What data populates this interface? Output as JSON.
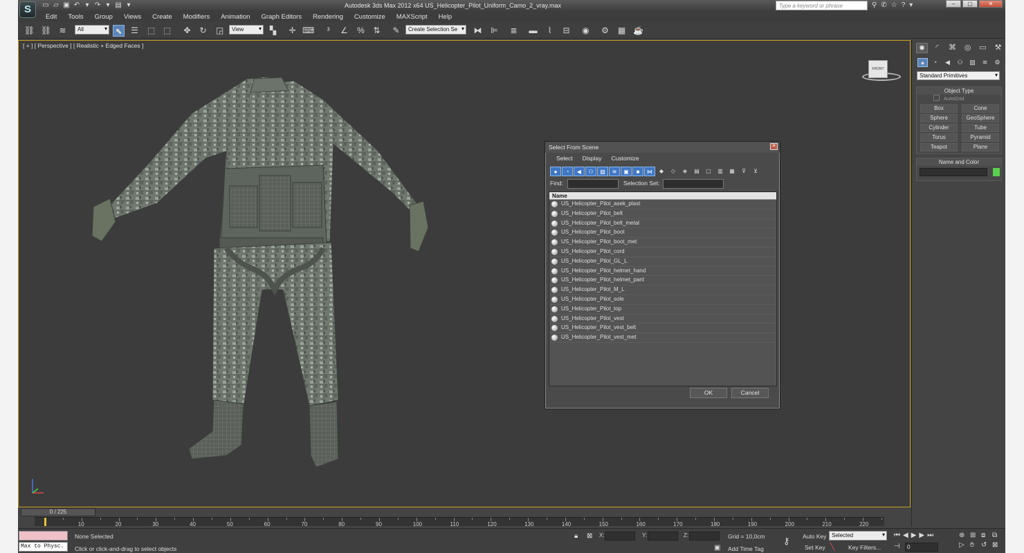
{
  "app": {
    "logo_glyph": "S",
    "title": "Autodesk 3ds Max  2012 x64      US_Helicopter_Pilot_Uniform_Camo_2_vray.max",
    "search_placeholder": "Type a keyword or phrase"
  },
  "menu": [
    "Edit",
    "Tools",
    "Group",
    "Views",
    "Create",
    "Modifiers",
    "Animation",
    "Graph Editors",
    "Rendering",
    "Customize",
    "MAXScript",
    "Help"
  ],
  "toolbar": {
    "selection_filter": "All",
    "ref_coord": "View",
    "named_selection": "Create Selection Se"
  },
  "viewport": {
    "label": "[ + ] [ Perspective ] [ Realistic + Edged Faces ]",
    "viewcube_face": "FRONT"
  },
  "dialog": {
    "title": "Select From Scene",
    "menu": [
      "Select",
      "Display",
      "Customize"
    ],
    "find_label": "Find:",
    "selection_set_label": "Selection Set:",
    "column_header": "Name",
    "objects": [
      "US_Helicopter_Pilot_asek_plast",
      "US_Helicopter_Pilot_belt",
      "US_Helicopter_Pilot_belt_metal",
      "US_Helicopter_Pilot_boot",
      "US_Helicopter_Pilot_boot_met",
      "US_Helicopter_Pilot_cord",
      "US_Helicopter_Pilot_GL_L",
      "US_Helicopter_Pilot_helmet_hand",
      "US_Helicopter_Pilot_helmet_pant",
      "US_Helicopter_Pilot_M_L",
      "US_Helicopter_Pilot_sole",
      "US_Helicopter_Pilot_top",
      "US_Helicopter_Pilot_vest",
      "US_Helicopter_Pilot_vest_belt",
      "US_Helicopter_Pilot_vest_met"
    ],
    "ok_label": "OK",
    "cancel_label": "Cancel"
  },
  "command_panel": {
    "category": "Standard Primitives",
    "object_type_header": "Object Type",
    "autogrid_label": "AutoGrid",
    "primitives": [
      "Box",
      "Cone",
      "Sphere",
      "GeoSphere",
      "Cylinder",
      "Tube",
      "Torus",
      "Pyramid",
      "Teapot",
      "Plane"
    ],
    "name_color_header": "Name and Color",
    "object_color": "#5ad050"
  },
  "timeline": {
    "slider_text": "0 / 225",
    "ticks": [
      "10",
      "20",
      "30",
      "40",
      "50",
      "60",
      "70",
      "80",
      "90",
      "100",
      "110",
      "120",
      "130",
      "140",
      "150",
      "160",
      "170",
      "180",
      "190",
      "200",
      "210",
      "220"
    ]
  },
  "status": {
    "maxscript_text": "Max to Physc.",
    "selection": "None Selected",
    "prompt": "Click or click-and-drag to select objects",
    "x_label": "X:",
    "y_label": "Y:",
    "z_label": "Z:",
    "grid": "Grid = 10,0cm",
    "add_time_tag": "Add Time Tag",
    "auto_key": "Auto Key",
    "auto_key_mode": "Selected",
    "set_key": "Set Key",
    "key_filters": "Key Filters...",
    "current_frame": "0"
  }
}
